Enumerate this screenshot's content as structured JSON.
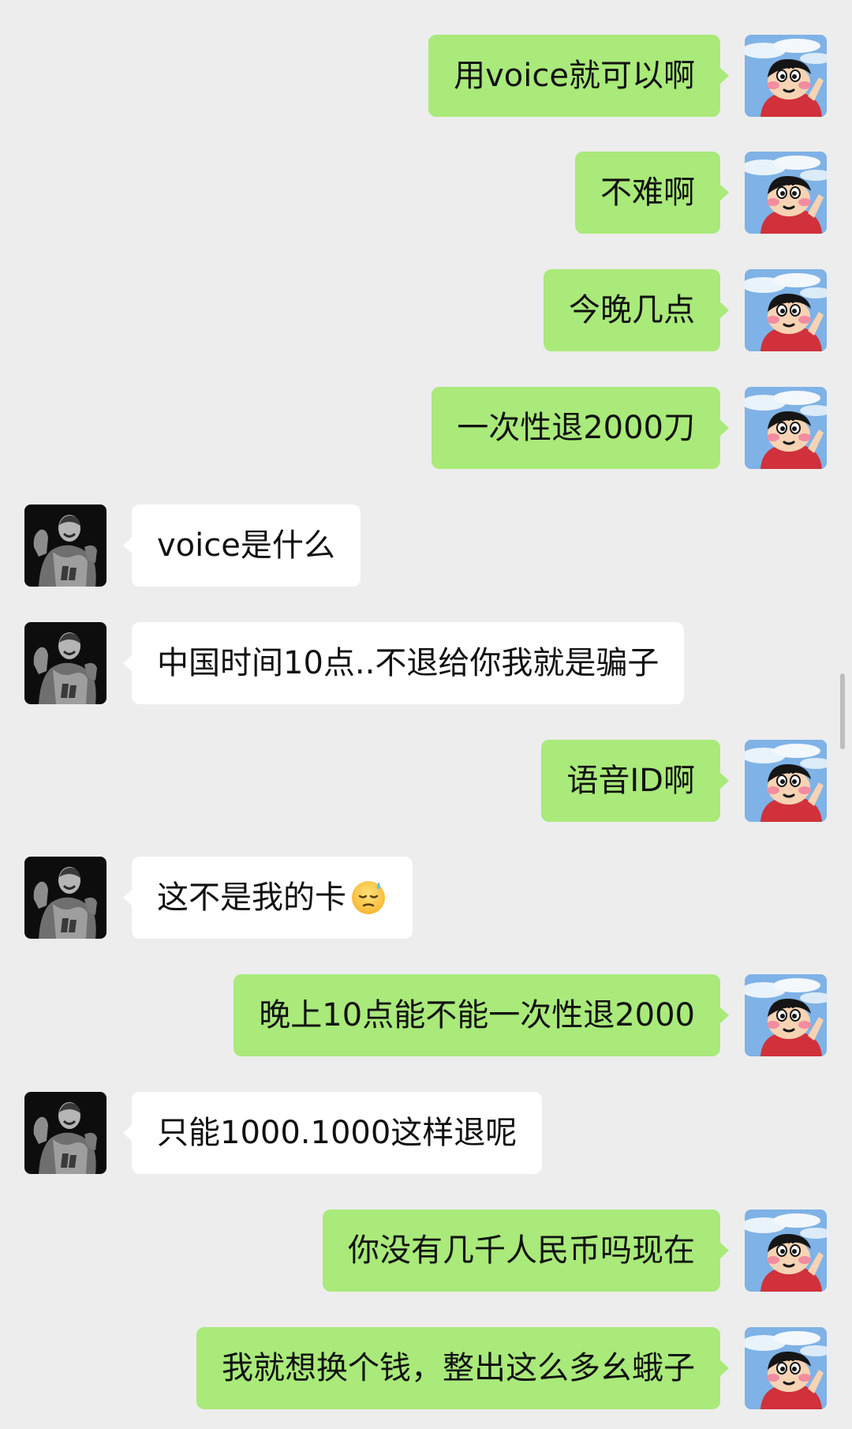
{
  "colors": {
    "background": "#EDEDED",
    "outgoing_bubble": "#A9EA7A",
    "incoming_bubble": "#FFFFFF",
    "text": "#111111"
  },
  "messages": [
    {
      "side": "out",
      "avatar": "shin-chan-avatar",
      "text": "用voice就可以啊"
    },
    {
      "side": "out",
      "avatar": "shin-chan-avatar",
      "text": "不难啊"
    },
    {
      "side": "out",
      "avatar": "shin-chan-avatar",
      "text": "今晚几点"
    },
    {
      "side": "out",
      "avatar": "shin-chan-avatar",
      "text": "一次性退2000刀"
    },
    {
      "side": "in",
      "avatar": "basketball-player-avatar",
      "text": "voice是什么"
    },
    {
      "side": "in",
      "avatar": "basketball-player-avatar",
      "text": "中国时间10点..不退给你我就是骗子"
    },
    {
      "side": "out",
      "avatar": "shin-chan-avatar",
      "text": "语音ID啊"
    },
    {
      "side": "in",
      "avatar": "basketball-player-avatar",
      "text": "这不是我的卡",
      "emoji": "downcast-sweat-face-emoji"
    },
    {
      "side": "out",
      "avatar": "shin-chan-avatar",
      "text": "晚上10点能不能一次性退2000"
    },
    {
      "side": "in",
      "avatar": "basketball-player-avatar",
      "text": "只能1000.1000这样退呢"
    },
    {
      "side": "out",
      "avatar": "shin-chan-avatar",
      "text": "你没有几千人民币吗现在"
    },
    {
      "side": "out",
      "avatar": "shin-chan-avatar",
      "text": "我就想换个钱，整出这么多幺蛾子"
    }
  ]
}
